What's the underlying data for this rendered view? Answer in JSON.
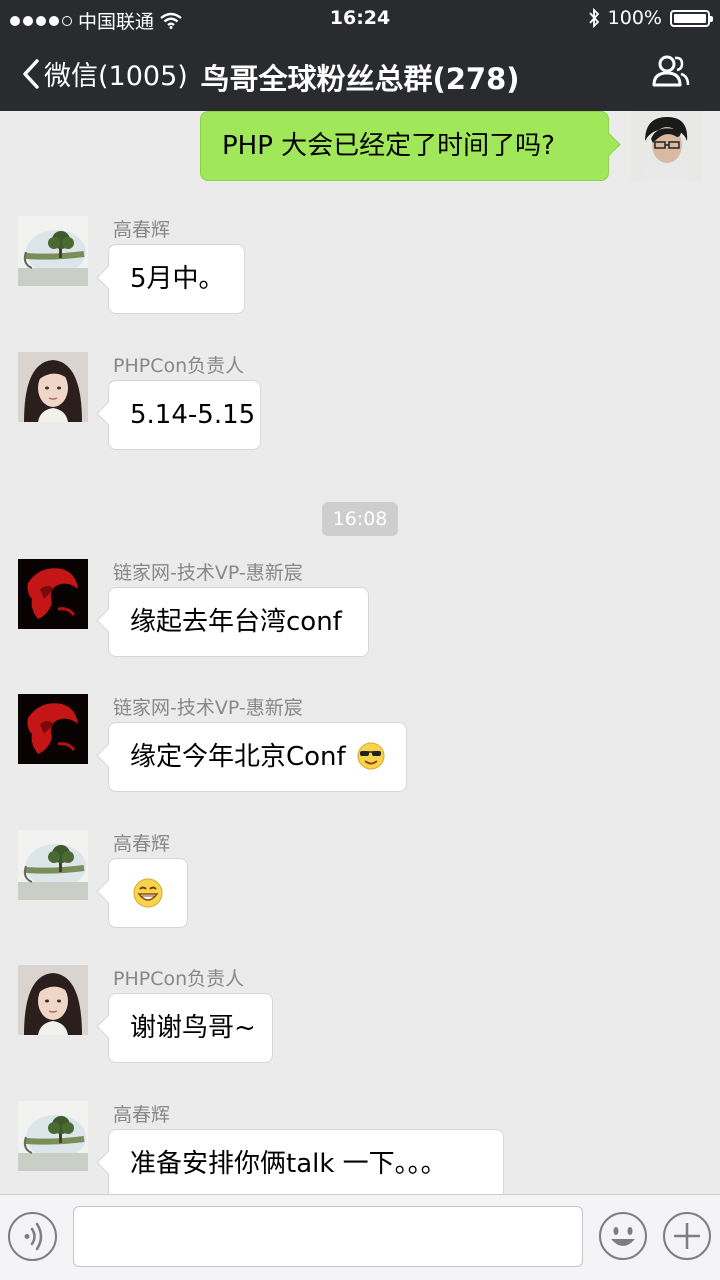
{
  "status": {
    "carrier": "中国联通",
    "time": "16:24",
    "battery": "100%",
    "battery_level": 1.0
  },
  "nav": {
    "back_label": "微信(1005)",
    "title": "鸟哥全球粉丝总群(278)"
  },
  "messages": [
    {
      "text": "PHP 大会已经定了时间了吗?"
    },
    {
      "sender": "高春辉",
      "text": "5月中。"
    },
    {
      "sender": "PHPCon负责人",
      "text": "5.14-5.15"
    },
    {
      "timestamp": "16:08"
    },
    {
      "sender": "链家网-技术VP-惠新宸",
      "text": "缘起去年台湾conf"
    },
    {
      "sender": "链家网-技术VP-惠新宸",
      "text": "缘定今年北京Conf"
    },
    {
      "sender": "高春辉"
    },
    {
      "sender": "PHPCon负责人",
      "text": "谢谢鸟哥~"
    },
    {
      "sender": "高春辉",
      "text": "准备安排你俩talk 一下。。。"
    }
  ],
  "icons": {
    "back": "chevron-left-icon",
    "contacts": "contacts-icon",
    "wifi": "wifi-icon",
    "bluetooth": "bluetooth-icon",
    "voice": "voice-icon",
    "emoji": "emoji-icon",
    "plus": "plus-icon"
  },
  "colors": {
    "topbar": "#2a2b2f",
    "my_bubble": "#a0e75a",
    "background": "#ebebeb"
  }
}
